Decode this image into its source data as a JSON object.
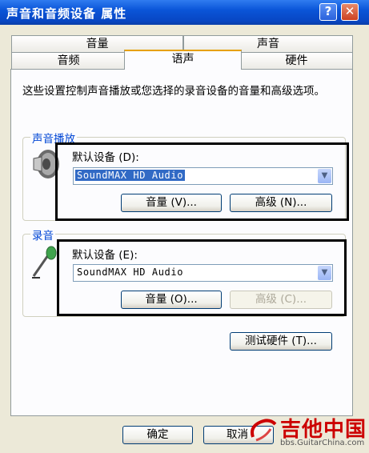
{
  "window": {
    "title": "声音和音频设备 属性",
    "help_glyph": "?",
    "close_glyph": "✕"
  },
  "tabs": {
    "row1": [
      "音量",
      "声音"
    ],
    "row2": [
      "音频",
      "语声",
      "硬件"
    ],
    "active": "语声"
  },
  "description": "这些设置控制声音播放或您选择的录音设备的音量和高级选项。",
  "playback": {
    "group_label": "声音播放",
    "device_label": "默认设备 (D):",
    "device_value": "SoundMAX HD Audio",
    "volume_button": "音量 (V)...",
    "advanced_button": "高级 (N)..."
  },
  "recording": {
    "group_label": "录音",
    "device_label": "默认设备 (E):",
    "device_value": "SoundMAX HD Audio",
    "volume_button": "音量 (O)...",
    "advanced_button": "高级 (C)..."
  },
  "test_button": "测试硬件 (T)...",
  "footer": {
    "ok": "确定",
    "cancel": "取消"
  },
  "watermark": {
    "text": "吉他中国",
    "url": "bbs.GuitarChina.com"
  },
  "colors": {
    "titlebar": "#0a55d8",
    "group_label": "#0046d5",
    "selection": "#316ac5",
    "highlight_box": "#000000"
  }
}
